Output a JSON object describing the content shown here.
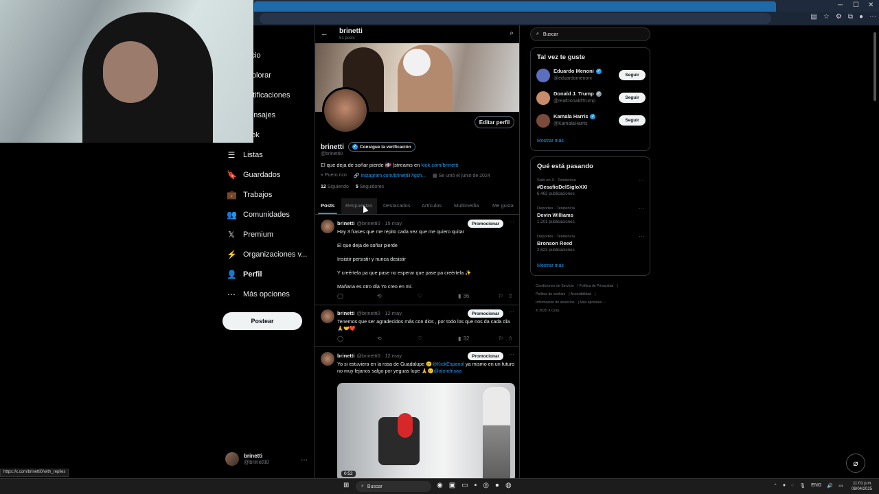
{
  "browser": {
    "window_controls": [
      "─",
      "☐",
      "✕"
    ],
    "status_url": "https://x.com/brinetti0/with_replies"
  },
  "sidebar": {
    "items": [
      {
        "label": "Inicio",
        "icon": "home-icon",
        "glyph": "⌂"
      },
      {
        "label": "Explorar",
        "icon": "search-icon",
        "glyph": "⌕"
      },
      {
        "label": "Notificaciones",
        "icon": "bell-icon",
        "glyph": "🔔"
      },
      {
        "label": "Mensajes",
        "icon": "mail-icon",
        "glyph": "✉"
      },
      {
        "label": "Grok",
        "icon": "grok-icon",
        "glyph": "◩"
      },
      {
        "label": "Listas",
        "icon": "list-icon",
        "glyph": "☰"
      },
      {
        "label": "Guardados",
        "icon": "bookmark-icon",
        "glyph": "🔖"
      },
      {
        "label": "Trabajos",
        "icon": "briefcase-icon",
        "glyph": "💼"
      },
      {
        "label": "Comunidades",
        "icon": "communities-icon",
        "glyph": "👥"
      },
      {
        "label": "Premium",
        "icon": "x-logo-icon",
        "glyph": "𝕏"
      },
      {
        "label": "Organizaciones v...",
        "icon": "lightning-icon",
        "glyph": "⚡"
      },
      {
        "label": "Perfil",
        "icon": "profile-icon",
        "glyph": "👤"
      },
      {
        "label": "Más opciones",
        "icon": "more-circle-icon",
        "glyph": "⋯"
      }
    ],
    "post_button": "Postear",
    "account": {
      "name": "brinetti",
      "handle": "@brinetti0"
    }
  },
  "profile": {
    "header_name": "brinetti",
    "header_posts": "51 posts",
    "edit_button": "Editar perfil",
    "name": "brinetti",
    "verify_badge": "Consigue la verificación",
    "handle": "@brinetti0",
    "bio_text": "El que deja de soñar pierde 🇩🇴 |streams en ",
    "bio_link": "kick.com/brinetti",
    "location": "Puero rico",
    "website": "instagram.com/brinettiii?igsh...",
    "joined": "Se unió el junio de 2024",
    "following_count": "12",
    "following_label": "Siguiendo",
    "followers_count": "5",
    "followers_label": "Seguidores"
  },
  "tabs": [
    "Posts",
    "Respuestas",
    "Destacados",
    "Artículos",
    "Multimedia",
    "Me gusta"
  ],
  "tweets": [
    {
      "name": "brinetti",
      "meta": "@brinetti0 · 15 may.",
      "promote": "Promocionar",
      "lines": [
        "Hay 3 frases que me repito cada vez que me quiero quitar",
        "El que deja de soñar pierde",
        "Insistir persistir y nunca desistir",
        "Y creértela pa que pase no esperar que pase pa creértela ✨",
        "Mañana es otro día Yo creo en mí."
      ],
      "views": "36"
    },
    {
      "name": "brinetti",
      "meta": "@brinetti0 · 12 may.",
      "promote": "Promocionar",
      "text": "Tenemos que ser agradecidos más con dios , por todo los que nos da cada día 🙏🤝❤️",
      "views": "32"
    },
    {
      "name": "brinetti",
      "meta": "@brinetti0 · 12 may.",
      "promote": "Promocionar",
      "text_a": "Yo si estuviera en la rosa de Guadalupe 🥲",
      "mention_a": "@KickEspanol",
      "text_b": " ya mismo en un futuro no muy lejanos salgo por yeguas lupe 🙏🥲",
      "mention_b": "@alondrisaa",
      "duration": "0:52"
    }
  ],
  "right": {
    "search_placeholder": "Buscar",
    "who_title": "Tal vez te guste",
    "suggestions": [
      {
        "name": "Eduardo Menoni",
        "handle": "@eduardomenoni",
        "button": "Seguir",
        "color": "#5a6fbf"
      },
      {
        "name": "Donald J. Trump",
        "handle": "@realDonaldTrump",
        "button": "Seguir",
        "color": "#c98c6a"
      },
      {
        "name": "Kamala Harris",
        "handle": "@KamalaHarris",
        "button": "Seguir",
        "color": "#7b4a3a"
      }
    ],
    "show_more": "Mostrar más",
    "trends_title": "Qué está pasando",
    "trends": [
      {
        "category": "Solo en X · Tendencia",
        "title": "#DesafioDelSigloXXI",
        "posts": "6.463 publicaciones"
      },
      {
        "category": "Deportes · Tendencia",
        "title": "Devin Williams",
        "posts": "1.201 publicaciones"
      },
      {
        "category": "Deportes · Tendencia",
        "title": "Bronson Reed",
        "posts": "2.623 publicaciones"
      }
    ],
    "show_more_trends": "Mostrar más",
    "footer": [
      "Condiciones de Servicio",
      "Política de Privacidad",
      "Política de cookies",
      "Accesibilidad",
      "Información de anuncios",
      "Más opciones ···",
      "© 2025 X Corp."
    ]
  },
  "taskbar": {
    "search": "Buscar",
    "lang": "ENG",
    "time": "11:01 p.m.",
    "date": "08/04/2025"
  }
}
